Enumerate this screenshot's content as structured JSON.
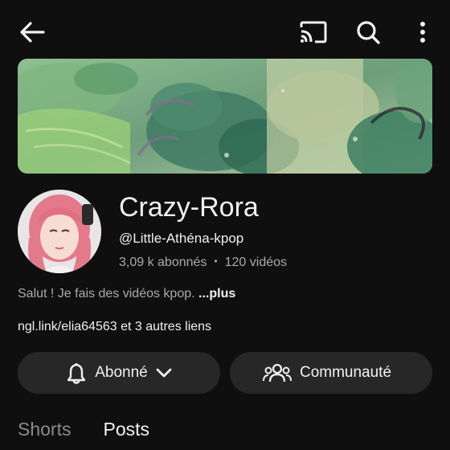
{
  "header": {
    "back_icon": "arrow-left-icon",
    "cast_icon": "cast-icon",
    "search_icon": "search-icon",
    "more_icon": "more-vertical-icon"
  },
  "channel": {
    "name": "Crazy-Rora",
    "handle": "@Little-Athéna-kpop",
    "subscribers": "3,09 k abonnés",
    "separator": "•",
    "videos": "120 vidéos",
    "description": "Salut ! Je fais des vidéos kpop.",
    "more_label": "...plus",
    "links_text": "ngl.link/elia64563 et 3 autres liens"
  },
  "actions": {
    "subscribed_label": "Abonné",
    "community_label": "Communauté"
  },
  "tabs": [
    {
      "label": "Shorts",
      "active": false
    },
    {
      "label": "Posts",
      "active": true
    }
  ],
  "colors": {
    "background": "#0f0f0f",
    "pill": "#272727",
    "text_primary": "#f1f1f1",
    "text_secondary": "#aaaaaa"
  }
}
